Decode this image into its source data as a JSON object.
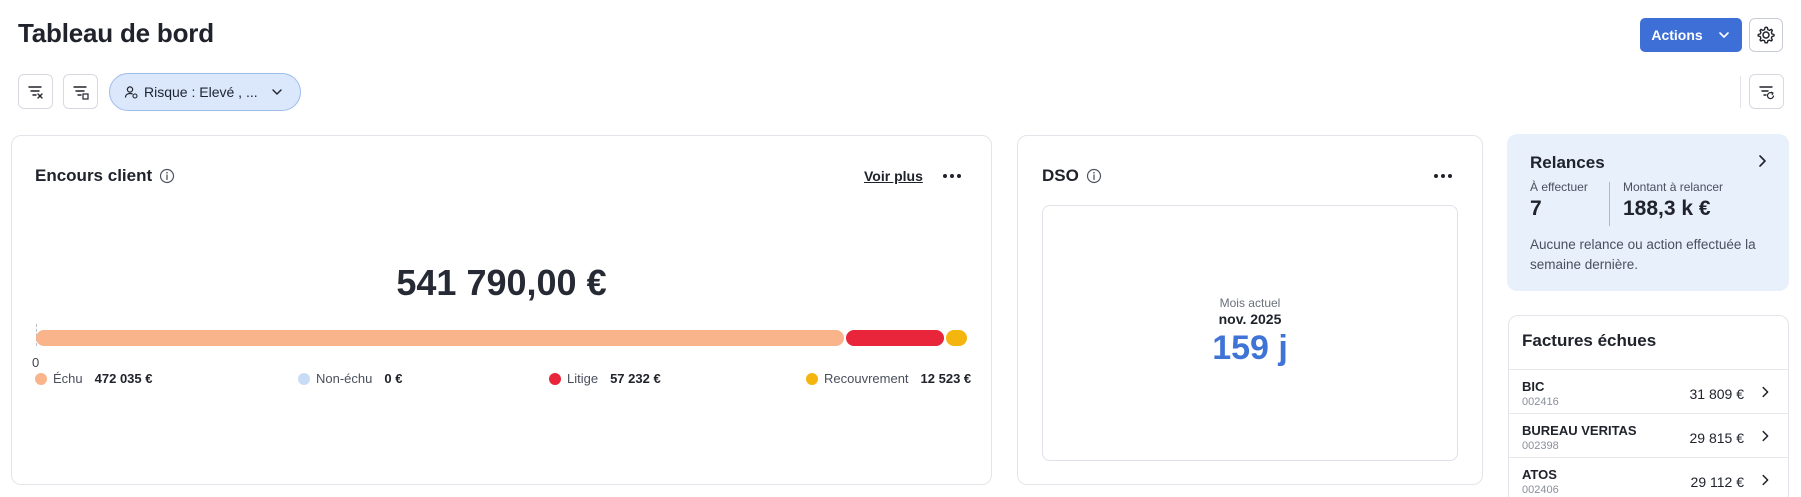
{
  "header": {
    "title": "Tableau de bord",
    "actions_label": "Actions"
  },
  "filters": {
    "chip_label": "Risque : Elevé , ..."
  },
  "encours": {
    "title": "Encours client",
    "voir_plus": "Voir plus",
    "total": "541 790,00 €",
    "zero_label": "0",
    "segments": [
      {
        "name": "Échu",
        "value": "472 035 €",
        "amount": 472035,
        "color": "#f9b48b"
      },
      {
        "name": "Non-échu",
        "value": "0 €",
        "amount": 0,
        "color": "#c9dcf5"
      },
      {
        "name": "Litige",
        "value": "57 232 €",
        "amount": 57232,
        "color": "#e8253a"
      },
      {
        "name": "Recouvrement",
        "value": "12 523 €",
        "amount": 12523,
        "color": "#f5b50f"
      }
    ]
  },
  "dso": {
    "title": "DSO",
    "period_caption": "Mois actuel",
    "period": "nov. 2025",
    "value": "159 j"
  },
  "relances": {
    "title": "Relances",
    "a_effectuer_label": "À effectuer",
    "a_effectuer_value": "7",
    "montant_label": "Montant à relancer",
    "montant_value": "188,3 k €",
    "message": "Aucune relance ou action effectuée la semaine dernière."
  },
  "factures": {
    "title": "Factures échues",
    "rows": [
      {
        "name": "BIC",
        "code": "002416",
        "amount": "31 809 €"
      },
      {
        "name": "BUREAU VERITAS",
        "code": "002398",
        "amount": "29 815 €"
      },
      {
        "name": "ATOS",
        "code": "002406",
        "amount": "29 112 €"
      }
    ]
  }
}
